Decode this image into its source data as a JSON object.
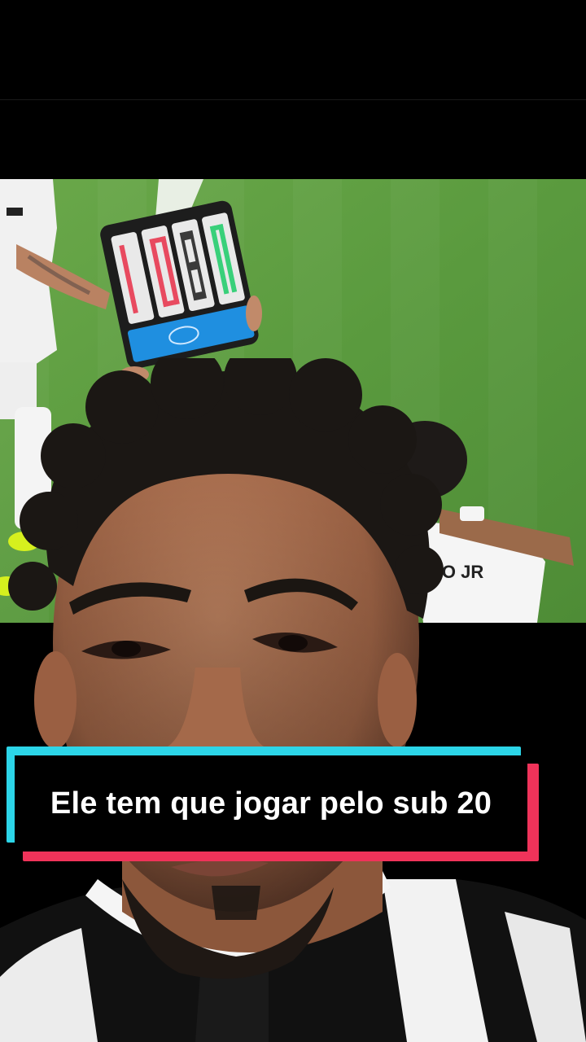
{
  "video": {
    "caption": "Ele tem que jogar pelo sub 20",
    "jersey_text": "HO JR"
  },
  "colors": {
    "caption_cyan": "#2cd5e8",
    "caption_red": "#f0335a",
    "pitch_green": "#5a9a3e",
    "board_blue": "#1f8fe0"
  }
}
